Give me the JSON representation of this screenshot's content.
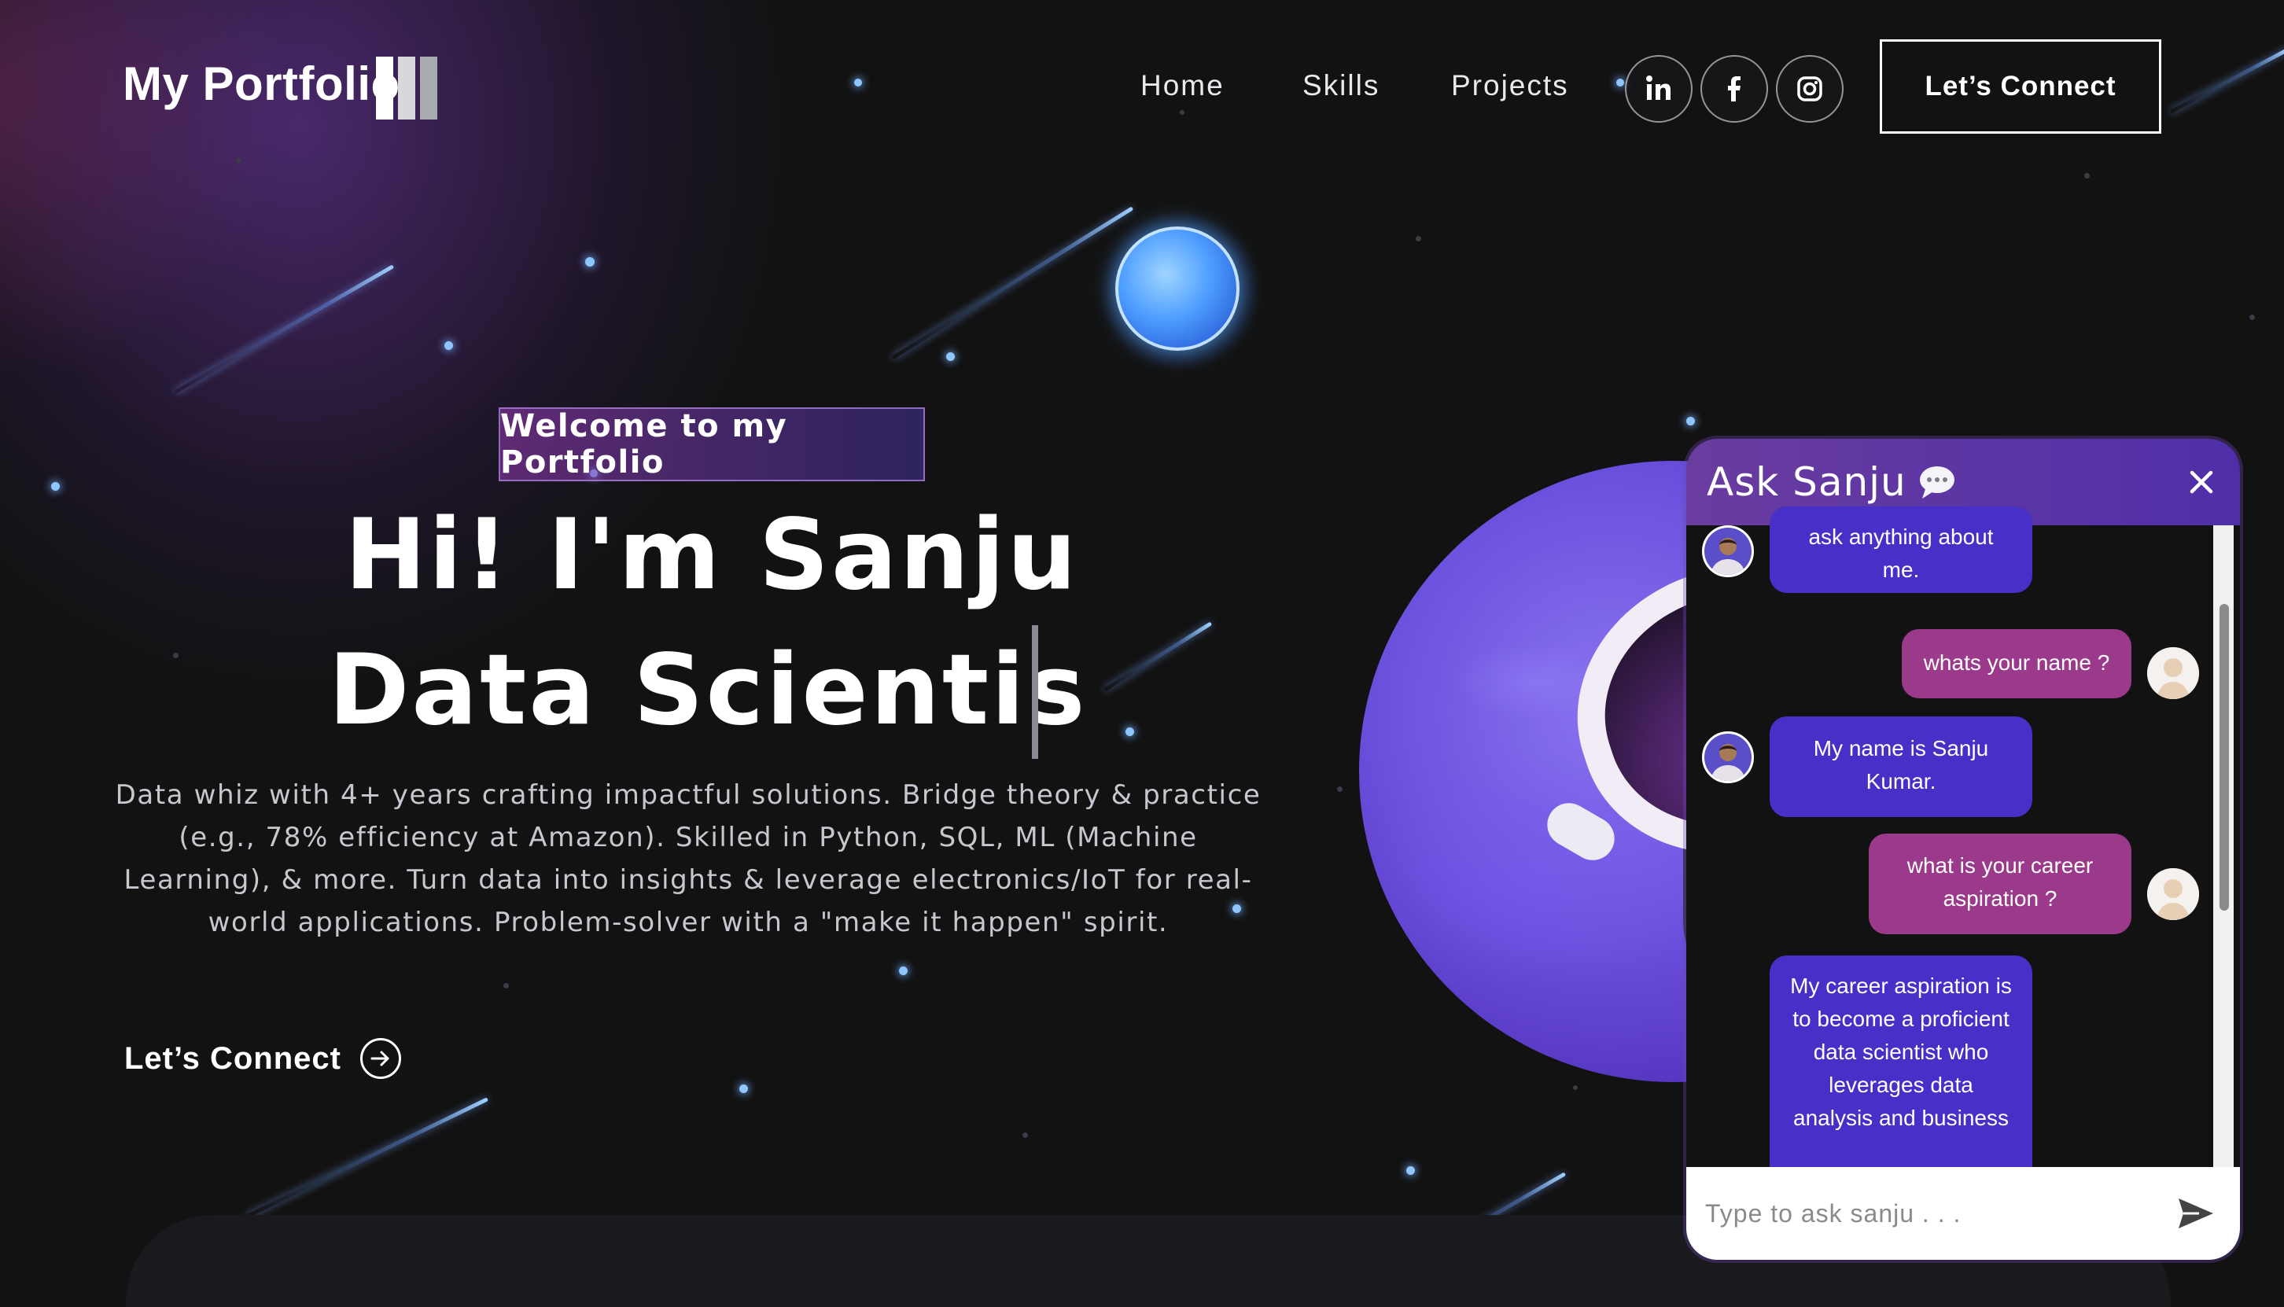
{
  "nav": {
    "logo": "My Portfolio",
    "links": [
      "Home",
      "Skills",
      "Projects"
    ],
    "social": [
      "linkedin-icon",
      "facebook-icon",
      "instagram-icon"
    ],
    "cta": "Let’s Connect"
  },
  "hero": {
    "tagline": "Welcome to my Portfolio",
    "greeting": "Hi! I'm Sanju",
    "typed_role": "Data Scientis",
    "description": "Data whiz with 4+ years crafting impactful solutions. Bridge theory & practice (e.g., 78% efficiency at Amazon). Skilled in Python, SQL, ML (Machine Learning), & more. Turn data into insights & leverage electronics/IoT for real-world applications. Problem-solver with a \"make it happen\" spirit.",
    "cta": "Let’s Connect"
  },
  "chat": {
    "title": "Ask Sanju",
    "messages": [
      {
        "from": "bot",
        "text": "ask anything about me."
      },
      {
        "from": "user",
        "text": "whats your name ?"
      },
      {
        "from": "bot",
        "text": "My name is Sanju Kumar."
      },
      {
        "from": "user",
        "text": "what is your career aspiration ?"
      },
      {
        "from": "bot",
        "text": "My career aspiration is to become a proficient data scientist who leverages data analysis and business"
      }
    ],
    "input_placeholder": "Type to ask sanju . . ."
  },
  "colors": {
    "bot_bubble": "#4630c8",
    "user_bubble": "#9b3a8a",
    "chat_header": "#5a35a5",
    "background": "#121212"
  }
}
